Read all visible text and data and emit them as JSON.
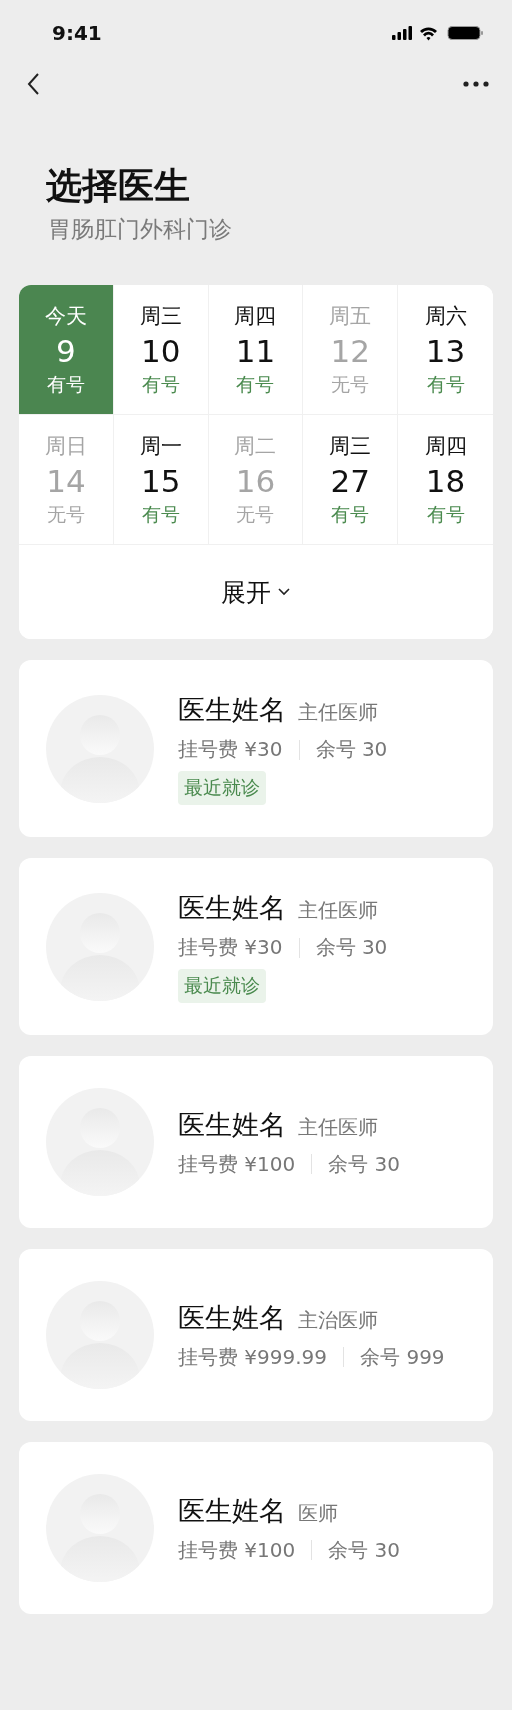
{
  "status_bar": {
    "time": "9:41"
  },
  "page": {
    "title": "选择医生",
    "subtitle": "胃肠肛门外科门诊"
  },
  "dates": [
    {
      "weekday": "今天",
      "day": "9",
      "availability": "有号",
      "available": true,
      "selected": true
    },
    {
      "weekday": "周三",
      "day": "10",
      "availability": "有号",
      "available": true,
      "selected": false
    },
    {
      "weekday": "周四",
      "day": "11",
      "availability": "有号",
      "available": true,
      "selected": false
    },
    {
      "weekday": "周五",
      "day": "12",
      "availability": "无号",
      "available": false,
      "selected": false
    },
    {
      "weekday": "周六",
      "day": "13",
      "availability": "有号",
      "available": true,
      "selected": false
    },
    {
      "weekday": "周日",
      "day": "14",
      "availability": "无号",
      "available": false,
      "selected": false
    },
    {
      "weekday": "周一",
      "day": "15",
      "availability": "有号",
      "available": true,
      "selected": false
    },
    {
      "weekday": "周二",
      "day": "16",
      "availability": "无号",
      "available": false,
      "selected": false
    },
    {
      "weekday": "周三",
      "day": "27",
      "availability": "有号",
      "available": true,
      "selected": false
    },
    {
      "weekday": "周四",
      "day": "18",
      "availability": "有号",
      "available": true,
      "selected": false
    }
  ],
  "expand_button": {
    "label": "展开"
  },
  "doctors": [
    {
      "name": "医生姓名",
      "title": "主任医师",
      "fee": "挂号费 ¥30",
      "remaining": "余号 30",
      "tag": "最近就诊"
    },
    {
      "name": "医生姓名",
      "title": "主任医师",
      "fee": "挂号费 ¥30",
      "remaining": "余号 30",
      "tag": "最近就诊"
    },
    {
      "name": "医生姓名",
      "title": "主任医师",
      "fee": "挂号费 ¥100",
      "remaining": "余号 30"
    },
    {
      "name": "医生姓名",
      "title": "主治医师",
      "fee": "挂号费 ¥999.99",
      "remaining": "余号 999"
    },
    {
      "name": "医生姓名",
      "title": "医师",
      "fee": "挂号费 ¥100",
      "remaining": "余号 30"
    }
  ]
}
